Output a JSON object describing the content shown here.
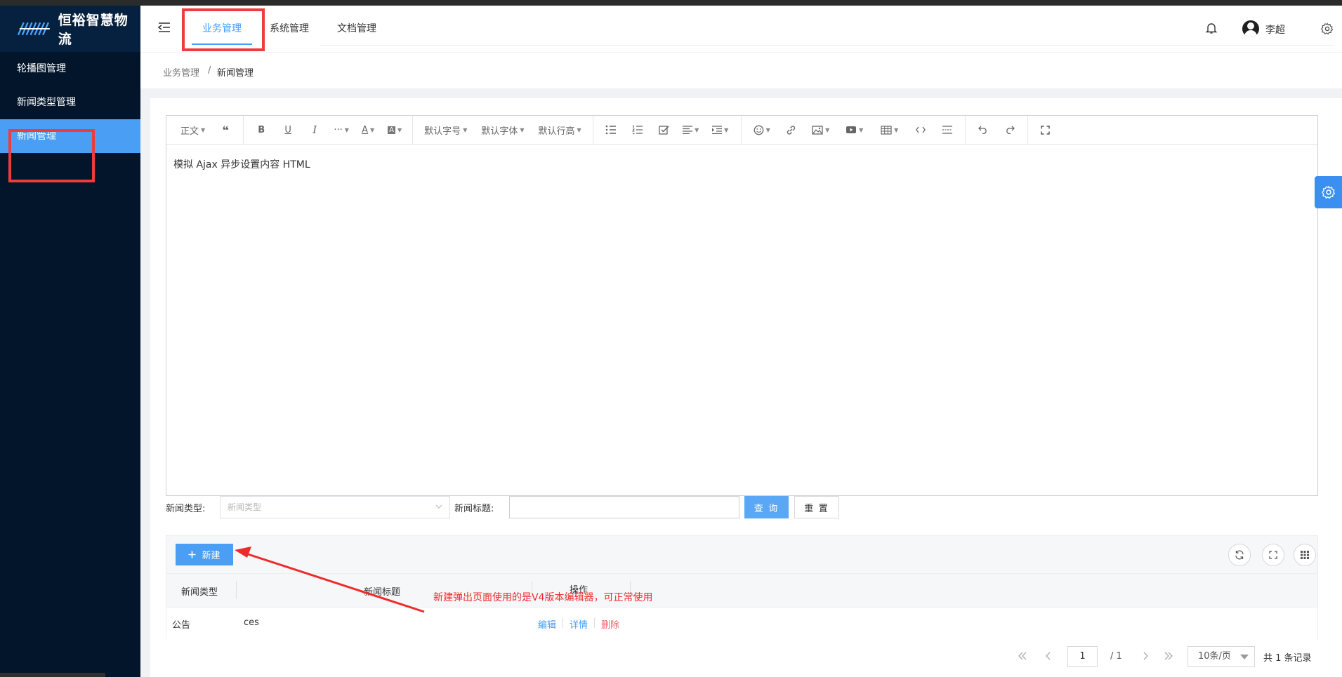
{
  "app": {
    "brand_text": "恒裕智慧物流"
  },
  "colors": {
    "accent": "#409eff",
    "sidebar_bg": "#03152b",
    "highlight_red": "#ee3b3b"
  },
  "sidebar": {
    "items": [
      {
        "label": "轮播图管理",
        "active": false
      },
      {
        "label": "新闻类型管理",
        "active": false
      },
      {
        "label": "新闻管理",
        "active": true
      }
    ]
  },
  "header": {
    "tabs": [
      {
        "label": "业务管理",
        "active": true
      },
      {
        "label": "系统管理",
        "active": false
      },
      {
        "label": "文档管理",
        "active": false
      }
    ],
    "username": "李超",
    "icons": [
      "menu-fold-icon",
      "bell-icon",
      "avatar",
      "settings-icon"
    ]
  },
  "breadcrumb": {
    "parent": "业务管理",
    "separator": "/",
    "current": "新闻管理"
  },
  "editor": {
    "toolbar": {
      "paragraph": "正文",
      "font_size": "默认字号",
      "font_family": "默认字体",
      "line_height": "默认行高"
    },
    "content": "模拟 Ajax 异步设置内容 HTML"
  },
  "filter": {
    "type_label": "新闻类型:",
    "type_placeholder": "新闻类型",
    "title_label": "新闻标题:",
    "title_value": "",
    "query_label": "查 询",
    "reset_label": "重 置"
  },
  "table": {
    "new_button_label": "新建",
    "columns": [
      "新闻类型",
      "新闻标题",
      "操作"
    ],
    "rows": [
      {
        "type": "公告",
        "title": "ces",
        "actions": {
          "edit": "编辑",
          "detail": "详情",
          "delete": "删除"
        }
      }
    ]
  },
  "annotation": {
    "text": "新建弹出页面使用的是V4版本编辑器，可正常使用"
  },
  "pagination": {
    "current_page": "1",
    "total_pages": "/ 1",
    "page_size": "10条/页",
    "total_records": "共 1 条记录"
  }
}
